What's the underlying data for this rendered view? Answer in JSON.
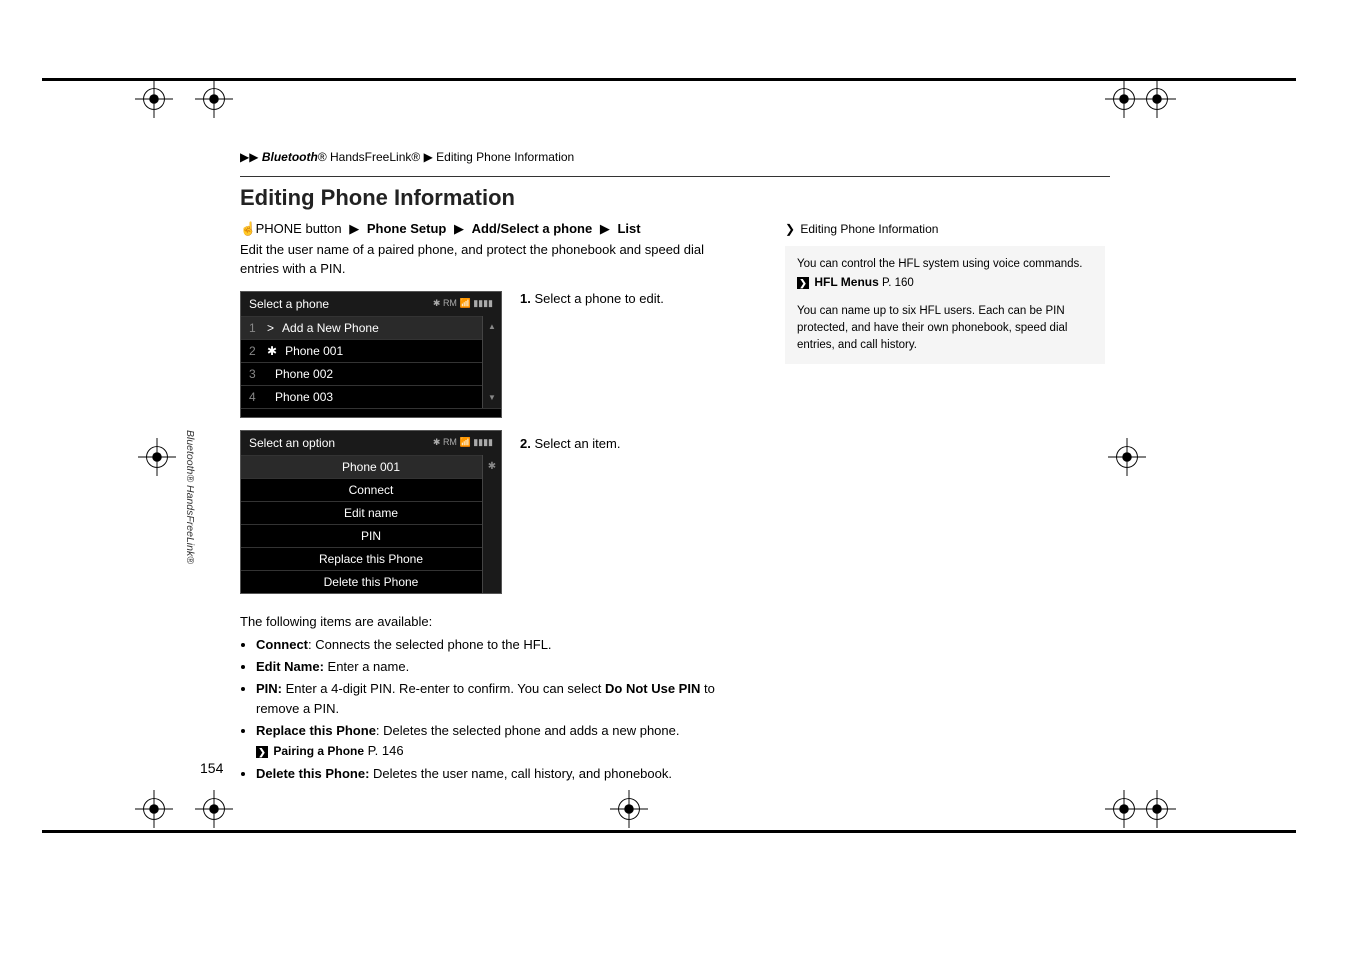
{
  "breadcrumb": {
    "a": "Bluetooth",
    "b": "® HandsFreeLink®",
    "c": "Editing Phone Information"
  },
  "title": "Editing Phone Information",
  "nav": {
    "btn": "PHONE button",
    "l1": "Phone Setup",
    "l2": "Add/Select a phone",
    "l3": "List"
  },
  "intro": "Edit the user name of a paired phone, and protect the phonebook and speed dial entries with a PIN.",
  "screen1": {
    "title": "Select a phone",
    "status": "RM",
    "rows": [
      {
        "n": "1",
        "pre": ">",
        "t": "Add a New Phone"
      },
      {
        "n": "2",
        "pre": "✱",
        "t": "Phone 001"
      },
      {
        "n": "3",
        "pre": "",
        "t": "Phone 002"
      },
      {
        "n": "4",
        "pre": "",
        "t": "Phone 003"
      }
    ],
    "up": "▲",
    "dn": "▼"
  },
  "step1": {
    "n": "1.",
    "t": "Select a phone to edit."
  },
  "screen2": {
    "title": "Select an option",
    "status": "RM",
    "selected": "Phone 001",
    "opts": [
      "Connect",
      "Edit name",
      "PIN",
      "Replace this Phone",
      "Delete this Phone"
    ]
  },
  "step2": {
    "n": "2.",
    "t": "Select an item."
  },
  "itemsIntro": "The following items are available:",
  "items": [
    {
      "b": "Connect",
      "t": ": Connects the selected phone to the HFL."
    },
    {
      "b": "Edit Name:",
      "t": " Enter a name."
    },
    {
      "b": "PIN:",
      "t": " Enter a 4-digit PIN. Re-enter to confirm. You can select ",
      "b2": "Do Not Use PIN",
      "t2": " to remove a PIN."
    },
    {
      "b": "Replace this Phone",
      "t": ": Deletes the selected phone and adds a new phone.",
      "xref": "Pairing a Phone",
      "xpage": "P. 146"
    },
    {
      "b": "Delete this Phone:",
      "t": " Deletes the user name, call history, and phonebook."
    }
  ],
  "side": {
    "title": "Editing Phone Information",
    "p1": "You can control the HFL system using voice commands.",
    "xref": "HFL Menus",
    "xpage": "P. 160",
    "p2": "You can name up to six HFL users. Each can be PIN protected, and have their own phonebook, speed dial entries, and call history."
  },
  "pageNumber": "154",
  "vlabel": "Bluetooth® HandsFreeLink®",
  "tri": "▶",
  "dbltri": "▶▶",
  "xicon": "❯",
  "bt": "✱",
  "signal": "📶",
  "batt": "▮▮▮▮"
}
